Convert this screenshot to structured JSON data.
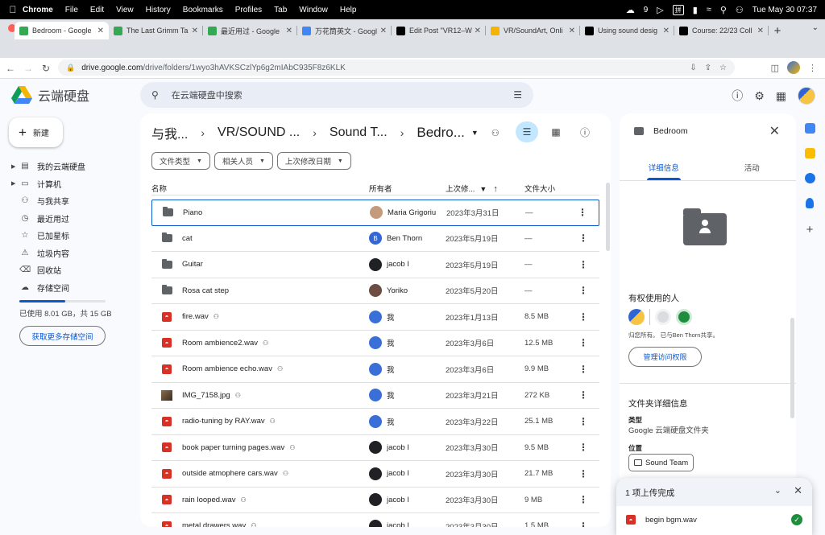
{
  "menubar": {
    "items": [
      "Chrome",
      "File",
      "Edit",
      "View",
      "History",
      "Bookmarks",
      "Profiles",
      "Tab",
      "Window",
      "Help"
    ],
    "notif_count": "9",
    "ime": "拼",
    "datetime": "Tue May 30  07:37"
  },
  "tabs": [
    {
      "title": "Bedroom - Google",
      "active": true,
      "fav_color": "#34a853"
    },
    {
      "title": "The Last Grimm Ta",
      "active": false,
      "fav_color": "#34a853"
    },
    {
      "title": "最近用过 - Google",
      "active": false,
      "fav_color": "#34a853"
    },
    {
      "title": "万花筒英文 - Googl",
      "active": false,
      "fav_color": "#4285f4"
    },
    {
      "title": "Edit Post \"VR12–W",
      "active": false,
      "fav_color": "#000000"
    },
    {
      "title": "VR/SoundArt, Onli",
      "active": false,
      "fav_color": "#f4b400"
    },
    {
      "title": "Using sound desig",
      "active": false,
      "fav_color": "#000000"
    },
    {
      "title": "Course: 22/23 Coll",
      "active": false,
      "fav_color": "#000000"
    }
  ],
  "address": {
    "host": "drive.google.com",
    "path": "/drive/folders/1wyo3hAVKSCzlYp6g2mIAbC935F8z6KLK"
  },
  "drive": {
    "brand": "云端硬盘",
    "search_placeholder": "在云端硬盘中搜索",
    "new_label": "新建"
  },
  "nav": [
    {
      "label": "我的云端硬盘",
      "icon": "my-drive-icon",
      "caret": true
    },
    {
      "label": "计算机",
      "icon": "computer-icon",
      "caret": true
    },
    {
      "label": "与我共享",
      "icon": "people-icon",
      "caret": false
    },
    {
      "label": "最近用过",
      "icon": "clock-icon",
      "caret": false
    },
    {
      "label": "已加星标",
      "icon": "star-icon",
      "caret": false
    },
    {
      "label": "垃圾内容",
      "icon": "spam-icon",
      "caret": false
    },
    {
      "label": "回收站",
      "icon": "trash-icon",
      "caret": false
    },
    {
      "label": "存储空间",
      "icon": "cloud-icon",
      "caret": false
    }
  ],
  "storage": {
    "text": "已使用 8.01 GB，共 15 GB",
    "used_fraction": 0.534,
    "more_label": "获取更多存储空间"
  },
  "breadcrumbs": [
    "与我...",
    "VR/SOUND ...",
    "Sound T...",
    "Bedro..."
  ],
  "filters": [
    "文件类型",
    "相关人员",
    "上次修改日期"
  ],
  "columns": {
    "name": "名称",
    "owner": "所有者",
    "modified": "上次修...",
    "size": "文件大小"
  },
  "rows": [
    {
      "name": "Piano",
      "type": "folder",
      "shared": false,
      "owner": "Maria Grigoriu",
      "owner_color": "#c49a7c",
      "owner_initial": "",
      "date": "2023年3月31日",
      "size": "—",
      "selected": true
    },
    {
      "name": "cat",
      "type": "folder",
      "shared": false,
      "owner": "Ben Thorn",
      "owner_color": "#3367d6",
      "owner_initial": "B",
      "date": "2023年5月19日",
      "size": "—",
      "selected": false
    },
    {
      "name": "Guitar",
      "type": "folder",
      "shared": false,
      "owner": "jacob l",
      "owner_color": "#202124",
      "owner_initial": "",
      "date": "2023年5月19日",
      "size": "—",
      "selected": false
    },
    {
      "name": "Rosa cat step",
      "type": "folder",
      "shared": false,
      "owner": "Yoriko",
      "owner_color": "#6d4c41",
      "owner_initial": "",
      "date": "2023年5月20日",
      "size": "—",
      "selected": false
    },
    {
      "name": "fire.wav",
      "type": "audio",
      "shared": true,
      "owner": "我",
      "owner_color": "#3a6fd8",
      "owner_initial": "",
      "date": "2023年1月13日",
      "size": "8.5 MB",
      "selected": false
    },
    {
      "name": "Room ambience2.wav",
      "type": "audio",
      "shared": true,
      "owner": "我",
      "owner_color": "#3a6fd8",
      "owner_initial": "",
      "date": "2023年3月6日",
      "size": "12.5 MB",
      "selected": false
    },
    {
      "name": "Room ambience echo.wav",
      "type": "audio",
      "shared": true,
      "owner": "我",
      "owner_color": "#3a6fd8",
      "owner_initial": "",
      "date": "2023年3月6日",
      "size": "9.9 MB",
      "selected": false
    },
    {
      "name": "IMG_7158.jpg",
      "type": "image",
      "shared": true,
      "owner": "我",
      "owner_color": "#3a6fd8",
      "owner_initial": "",
      "date": "2023年3月21日",
      "size": "272 KB",
      "selected": false
    },
    {
      "name": "radio-tuning by RAY.wav",
      "type": "audio",
      "shared": true,
      "owner": "我",
      "owner_color": "#3a6fd8",
      "owner_initial": "",
      "date": "2023年3月22日",
      "size": "25.1 MB",
      "selected": false
    },
    {
      "name": "book paper turning pages.wav",
      "type": "audio",
      "shared": true,
      "owner": "jacob l",
      "owner_color": "#202124",
      "owner_initial": "",
      "date": "2023年3月30日",
      "size": "9.5 MB",
      "selected": false
    },
    {
      "name": "outside atmophere cars.wav",
      "type": "audio",
      "shared": true,
      "owner": "jacob l",
      "owner_color": "#202124",
      "owner_initial": "",
      "date": "2023年3月30日",
      "size": "21.7 MB",
      "selected": false
    },
    {
      "name": "rain looped.wav",
      "type": "audio",
      "shared": true,
      "owner": "jacob l",
      "owner_color": "#202124",
      "owner_initial": "",
      "date": "2023年3月30日",
      "size": "9 MB",
      "selected": false
    },
    {
      "name": "metal drawers.wav",
      "type": "audio",
      "shared": true,
      "owner": "jacob l",
      "owner_color": "#202124",
      "owner_initial": "",
      "date": "2023年3月30日",
      "size": "1.5 MB",
      "selected": false
    }
  ],
  "details": {
    "title": "Bedroom",
    "tab_details": "详细信息",
    "tab_activity": "活动",
    "access_heading": "有权使用的人",
    "access_note": "归您所有。 已与Ben Thorn共享。",
    "manage_label": "管理访问权限",
    "folder_heading": "文件夹详细信息",
    "type_label": "类型",
    "type_value": "Google 云端硬盘文件夹",
    "location_label": "位置",
    "location_value": "Sound Team"
  },
  "upload": {
    "title": "1 项上传完成",
    "file": "begin bgm.wav"
  },
  "colors": {
    "accent": "#0b57d0",
    "selected_chip": "#c2e7ff",
    "audio_icon": "#d93025",
    "success": "#1e8e3e"
  }
}
